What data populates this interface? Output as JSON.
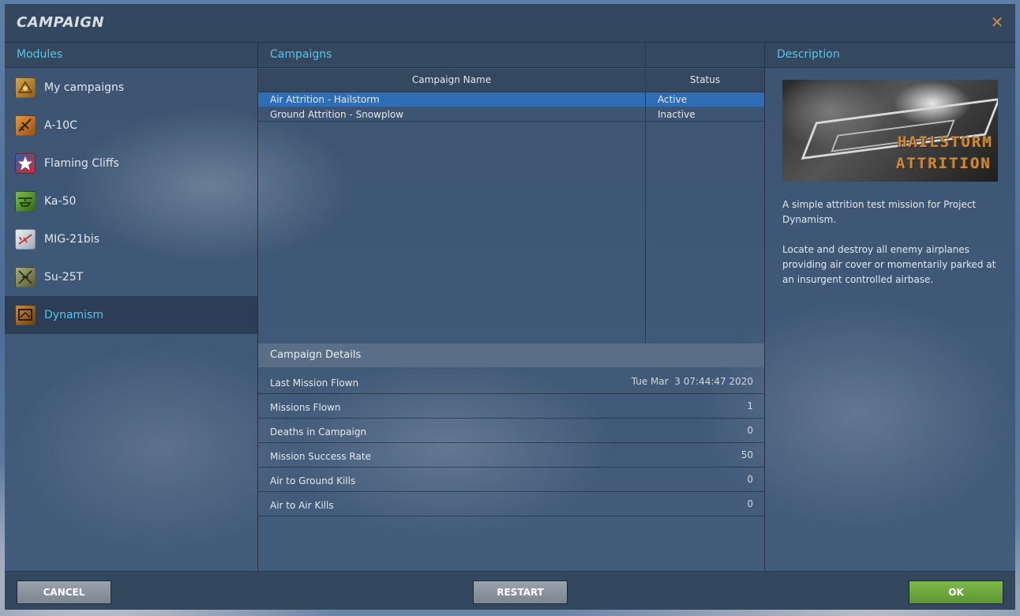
{
  "window": {
    "title": "CAMPAIGN",
    "close_icon": "close-icon"
  },
  "columns": {
    "modules": "Modules",
    "campaigns": "Campaigns",
    "description": "Description"
  },
  "modules": [
    {
      "label": "My campaigns",
      "icon": "folder-star-icon",
      "color": "#b8862f"
    },
    {
      "label": "A-10C",
      "icon": "a10c-module-icon",
      "color": "#c77a2a"
    },
    {
      "label": "Flaming Cliffs",
      "icon": "flaming-cliffs-star-icon",
      "color": "#d02a2a"
    },
    {
      "label": "Ka-50",
      "icon": "ka50-module-icon",
      "color": "#4d8a2e"
    },
    {
      "label": "MIG-21bis",
      "icon": "mig21-module-icon",
      "color": "#c9d4de"
    },
    {
      "label": "Su-25T",
      "icon": "su25t-module-icon",
      "color": "#7a7f52"
    },
    {
      "label": "Dynamism",
      "icon": "dynamism-module-icon",
      "color": "#a86a2c",
      "selected": true
    }
  ],
  "campaign_table": {
    "headers": {
      "name": "Campaign Name",
      "status": "Status"
    },
    "rows": [
      {
        "name": "Air Attrition - Hailstorm",
        "status": "Active",
        "selected": true
      },
      {
        "name": "Ground Attrition - Snowplow",
        "status": "Inactive",
        "selected": false
      }
    ]
  },
  "details": {
    "title": "Campaign Details",
    "rows": [
      {
        "label": "Last Mission Flown",
        "value": "Tue Mar  3 07:44:47 2020"
      },
      {
        "label": "Missions Flown",
        "value": "1"
      },
      {
        "label": "Deaths in Campaign",
        "value": "0"
      },
      {
        "label": "Mission Success Rate",
        "value": "50"
      },
      {
        "label": "Air to Ground Kills",
        "value": "0"
      },
      {
        "label": "Air to Air Kills",
        "value": "0"
      }
    ]
  },
  "description": {
    "image_text_line1": "HAILSTORM",
    "image_text_line2": "ATTRITION",
    "paragraph1": "A simple attrition test mission for Project Dynamism.",
    "paragraph2": "Locate and destroy all enemy airplanes providing air cover or momentarily parked at an insurgent controlled airbase."
  },
  "footer": {
    "cancel_label": "CANCEL",
    "restart_label": "RESTART",
    "ok_label": "OK"
  },
  "colors": {
    "accent": "#5cc2e8",
    "selection": "#2f6eb5",
    "ok_button": "#6ea63f",
    "close_icon": "#c98a4b"
  }
}
